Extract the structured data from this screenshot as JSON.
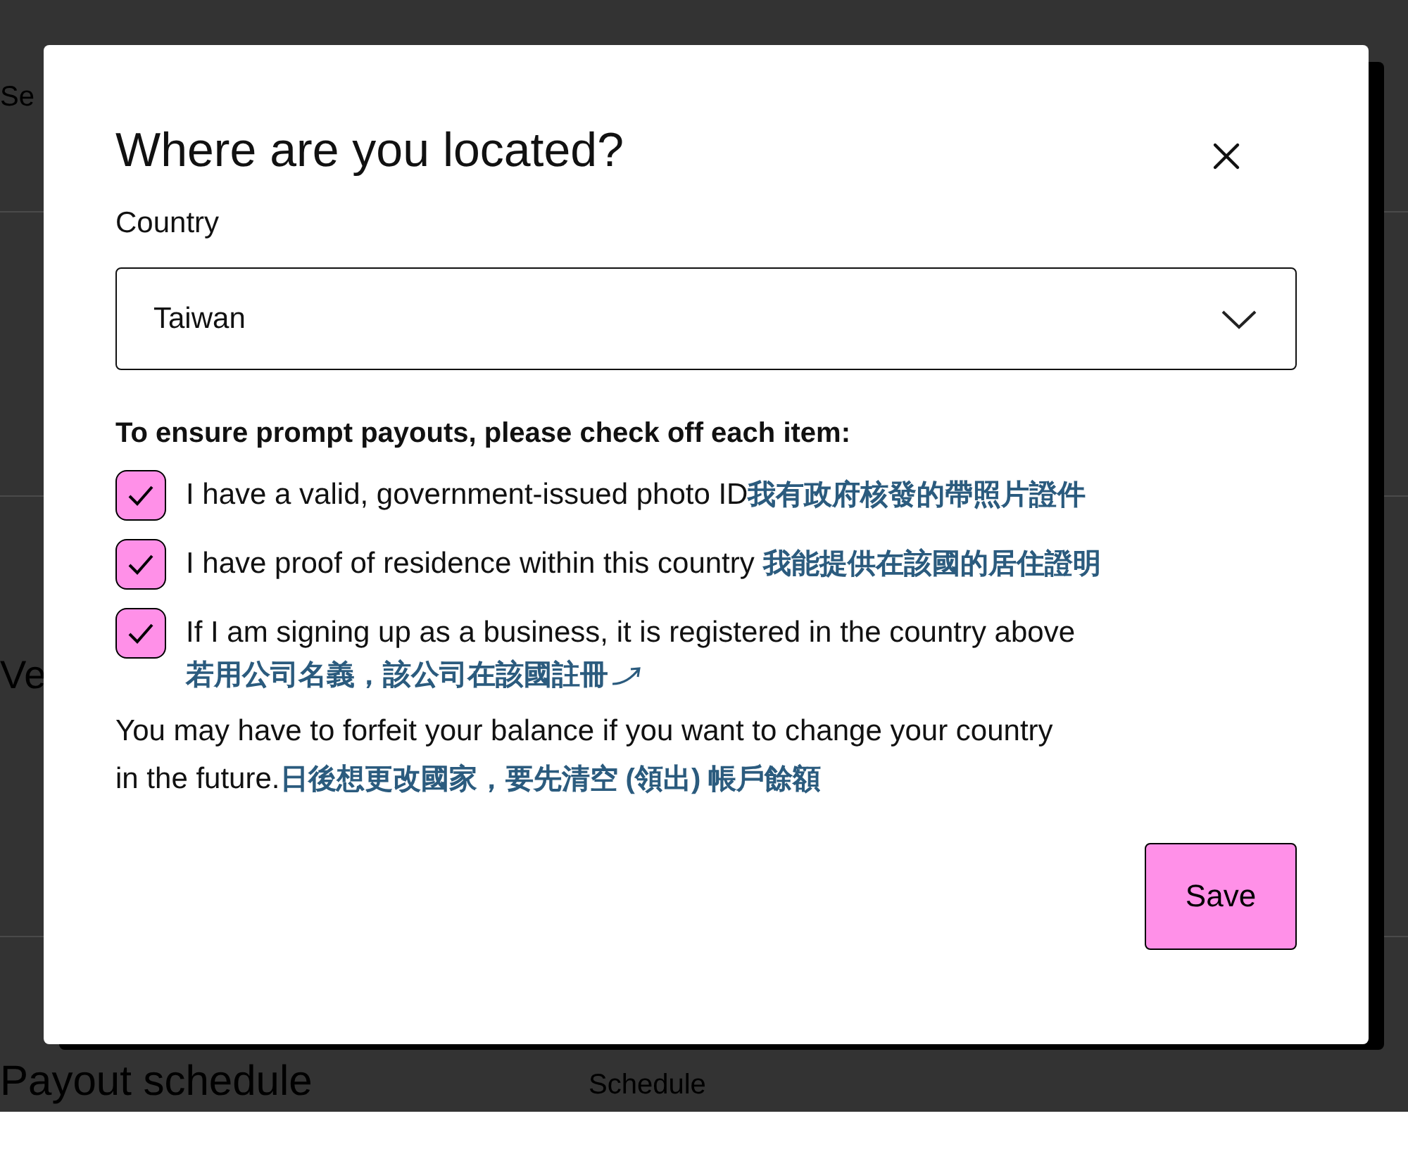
{
  "background": {
    "texts": [
      {
        "text": "Se",
        "kind": "top"
      },
      {
        "text": "Ve",
        "kind": "middle"
      },
      {
        "text": "Payout schedule",
        "kind": "bottom"
      },
      {
        "text": "Schedule",
        "kind": "sub"
      }
    ]
  },
  "dialog": {
    "title": "Where are you located?",
    "country_label": "Country",
    "country": {
      "value": "Taiwan"
    },
    "checklist_heading": "To ensure prompt payouts, please check off each item:",
    "items": [
      {
        "label": "I have a valid, government-issued photo ID",
        "note": "我有政府核發的帶照片證件",
        "checked": true
      },
      {
        "label": "I have proof of residence within this country",
        "note": "我能提供在該國的居住證明",
        "checked": true
      },
      {
        "label": "If I am signing up as a business, it is registered in the country above",
        "note": "若用公司名義，該公司在該國註冊",
        "checked": true
      }
    ],
    "warning": {
      "lines": [
        "You may have to forfeit your balance if you want to change your country",
        "in the future."
      ],
      "note": "日後想更改國家，要先清空 (領出) 帳戶餘額"
    },
    "save_button": "Save"
  }
}
